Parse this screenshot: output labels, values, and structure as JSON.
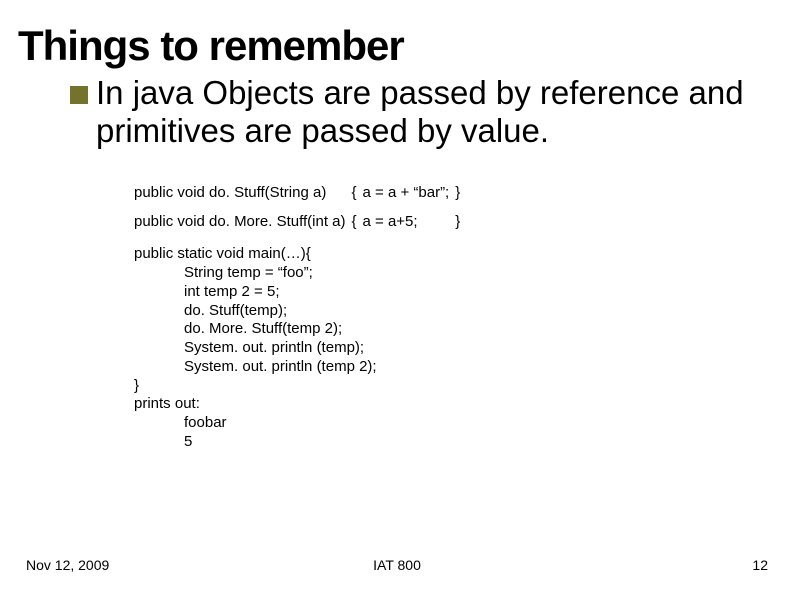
{
  "title": "Things to remember",
  "bullet": "In java Objects are passed by reference and primitives are passed by value.",
  "code": {
    "row1": {
      "sig": "public void do. Stuff(String a)",
      "open": "{",
      "body": "a = a + “bar”;",
      "close": "}"
    },
    "row2": {
      "sig": "public void do. More. Stuff(int a)",
      "open": "{",
      "body": "a = a+5;",
      "close": "}"
    },
    "main": "public static void main(…){\n            String temp = “foo”;\n            int temp 2 = 5;\n            do. Stuff(temp);\n            do. More. Stuff(temp 2);\n            System. out. println (temp);\n            System. out. println (temp 2);\n}\nprints out:\n            foobar\n            5"
  },
  "footer": {
    "date": "Nov 12, 2009",
    "center": "IAT 800",
    "page": "12"
  }
}
